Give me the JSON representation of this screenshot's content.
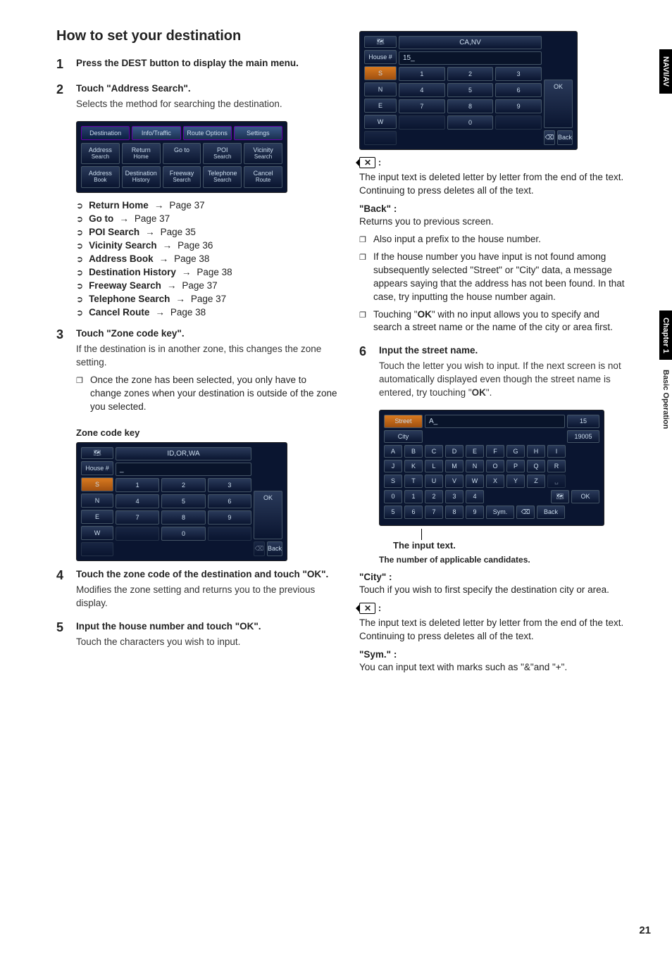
{
  "title": "How to set your destination",
  "sidebar": {
    "nav": "NAVI/AV",
    "chapter": "Chapter 1",
    "section": "Basic Operation"
  },
  "pageNumber": "21",
  "step1": {
    "head_a": "Press the ",
    "head_b": "DEST",
    "head_c": " button to display the main menu."
  },
  "step2": {
    "head": "Touch \"Address Search\".",
    "desc": "Selects the method for searching the destination."
  },
  "devTabs": [
    "Destination",
    "Info/Traffic",
    "Route Options",
    "Settings"
  ],
  "devGrid": [
    {
      "t": "Address",
      "s": "Search"
    },
    {
      "t": "Return",
      "s": "Home"
    },
    {
      "t": "Go to",
      "s": ""
    },
    {
      "t": "POI",
      "s": "Search"
    },
    {
      "t": "Vicinity",
      "s": "Search"
    },
    {
      "t": "Address",
      "s": "Book"
    },
    {
      "t": "Destination",
      "s": "History"
    },
    {
      "t": "Freeway",
      "s": "Search"
    },
    {
      "t": "Telephone",
      "s": "Search"
    },
    {
      "t": "Cancel",
      "s": "Route"
    }
  ],
  "xrefs": [
    {
      "label": "Return Home",
      "page": "Page 37"
    },
    {
      "label": "Go to",
      "page": "Page 37"
    },
    {
      "label": "POI Search",
      "page": "Page 35"
    },
    {
      "label": "Vicinity Search",
      "page": "Page 36"
    },
    {
      "label": "Address Book",
      "page": "Page 38"
    },
    {
      "label": "Destination History",
      "page": "Page 38"
    },
    {
      "label": "Freeway Search",
      "page": "Page 37"
    },
    {
      "label": "Telephone Search",
      "page": "Page 37"
    },
    {
      "label": "Cancel Route",
      "page": "Page 38"
    }
  ],
  "step3": {
    "head": "Touch \"Zone code key\".",
    "desc": "If the destination is in another zone, this changes the zone setting.",
    "note": "Once the zone has been selected, you only have to change zones when your destination is outside of the zone you selected.",
    "caption": "Zone code key"
  },
  "zoneDev": {
    "header": "ID,OR,WA",
    "houseLabel": "House #",
    "input": "_",
    "sideKeys": [
      "S",
      "N",
      "E",
      "W",
      ""
    ],
    "num": [
      [
        "1",
        "2",
        "3"
      ],
      [
        "4",
        "5",
        "6"
      ],
      [
        "7",
        "8",
        "9"
      ],
      [
        "",
        "0",
        ""
      ]
    ],
    "ok": "OK",
    "back": "Back",
    "delIcon": "⌫"
  },
  "step4": {
    "head": "Touch the zone code of the destination and touch \"OK\".",
    "desc": "Modifies the zone setting and returns you to the previous display."
  },
  "step5": {
    "head": "Input the house number and touch \"OK\".",
    "desc": "Touch the characters you wish to input."
  },
  "houseDev": {
    "header": "CA,NV",
    "houseLabel": "House #",
    "input": "15_",
    "sideKeys": [
      "S",
      "N",
      "E",
      "W",
      ""
    ],
    "num": [
      [
        "1",
        "2",
        "3"
      ],
      [
        "4",
        "5",
        "6"
      ],
      [
        "7",
        "8",
        "9"
      ],
      [
        "",
        "0",
        ""
      ]
    ],
    "ok": "OK",
    "back": "Back",
    "delIcon": "⌫"
  },
  "delIconLabel": "✕",
  "delDesc": "The input text is deleted letter by letter from the end of the text. Continuing to press deletes all of the text.",
  "backHead": "\"Back\" :",
  "backDesc": "Returns you to previous screen.",
  "backNotes": [
    "Also input a prefix to the house number.",
    "If the house number you have input is not found among subsequently selected \"Street\" or \"City\" data, a message appears saying that the address has not been found. In that case, try inputting the house number again.",
    "Touching \"OK\" with no input allows you to specify and search a street name or the name of the city or area first."
  ],
  "okBold": "OK",
  "step6": {
    "head": "Input the street name.",
    "desc_a": "Touch the letter you wish to input. If the next screen is not automatically displayed even though the street name is entered, try touching \"",
    "desc_b": "OK",
    "desc_c": "\"."
  },
  "kbd": {
    "streetLabel": "Street",
    "cityLabel": "City",
    "input": "A_",
    "count1": "15",
    "count2": "19005",
    "rows": [
      [
        "A",
        "B",
        "C",
        "D",
        "E",
        "F",
        "G",
        "H",
        "I"
      ],
      [
        "J",
        "K",
        "L",
        "M",
        "N",
        "O",
        "P",
        "Q",
        "R"
      ],
      [
        "S",
        "T",
        "U",
        "V",
        "W",
        "X",
        "Y",
        "Z"
      ],
      [
        "0",
        "1",
        "2",
        "3",
        "4"
      ],
      [
        "5",
        "6",
        "7",
        "8",
        "9",
        "Sym."
      ]
    ],
    "ok": "OK",
    "back": "Back",
    "delIcon": "⌫",
    "space": "␣"
  },
  "inputTextLabel": "The input text.",
  "candidatesLabel": "The number of applicable candidates.",
  "cityHead": "\"City\" :",
  "cityDesc": "Touch if you wish to first specify the destination city or area.",
  "delDesc2": "The input text is deleted letter by letter from the end of the text. Continuing to press deletes all of the text.",
  "symHead": "\"Sym.\" :",
  "symDesc": "You can input text with marks such as \"&\"and \"+\"."
}
